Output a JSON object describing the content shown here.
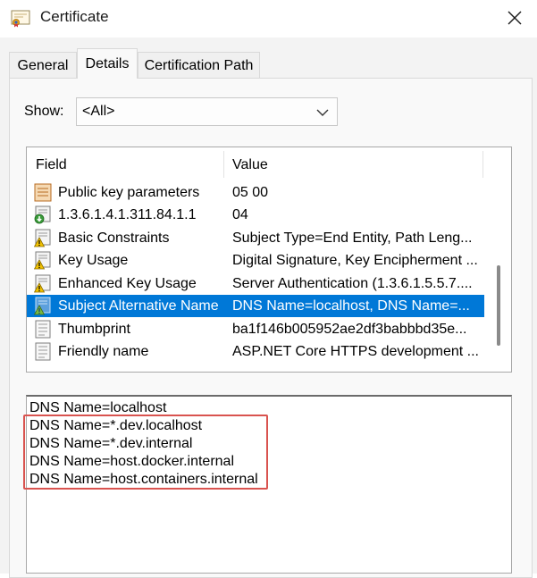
{
  "window": {
    "title": "Certificate"
  },
  "tabs": [
    {
      "label": "General"
    },
    {
      "label": "Details"
    },
    {
      "label": "Certification Path"
    }
  ],
  "show": {
    "label": "Show:",
    "value": "<All>"
  },
  "list": {
    "headers": {
      "field": "Field",
      "value": "Value"
    },
    "rows": [
      {
        "field": "Public key parameters",
        "value": "05 00",
        "icon": "certificate-field-icon"
      },
      {
        "field": "1.3.6.1.4.1.311.84.1.1",
        "value": "04",
        "icon": "extension-info-icon"
      },
      {
        "field": "Basic Constraints",
        "value": "Subject Type=End Entity, Path Leng...",
        "icon": "extension-warning-icon"
      },
      {
        "field": "Key Usage",
        "value": "Digital Signature, Key Encipherment ...",
        "icon": "extension-warning-icon"
      },
      {
        "field": "Enhanced Key Usage",
        "value": "Server Authentication (1.3.6.1.5.5.7....",
        "icon": "extension-warning-icon"
      },
      {
        "field": "Subject Alternative Name",
        "value": "DNS Name=localhost, DNS Name=...",
        "icon": "extension-warning-icon",
        "selected": true
      },
      {
        "field": "Thumbprint",
        "value": "ba1f146b005952ae2df3babbbd35e...",
        "icon": "document-icon"
      },
      {
        "field": "Friendly name",
        "value": "ASP.NET Core HTTPS development ...",
        "icon": "document-icon"
      }
    ]
  },
  "detail": {
    "lines": [
      "DNS Name=localhost",
      "DNS Name=*.dev.localhost",
      "DNS Name=*.dev.internal",
      "DNS Name=host.docker.internal",
      "DNS Name=host.containers.internal"
    ]
  },
  "colors": {
    "selection": "#0078d7",
    "highlight_box": "#d9534f"
  }
}
